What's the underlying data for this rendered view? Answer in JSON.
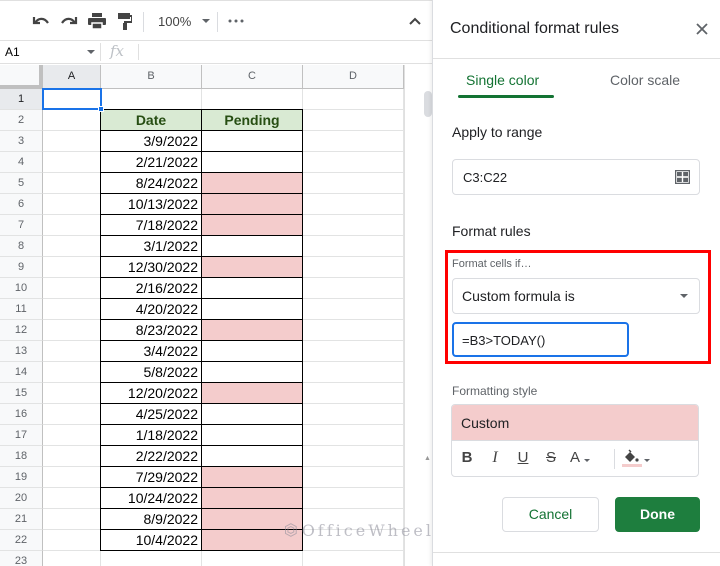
{
  "toolbar": {
    "undo_icon": "undo-icon",
    "redo_icon": "redo-icon",
    "print_icon": "print-icon",
    "paint_format_icon": "paint-format-icon",
    "zoom_level": "100%",
    "more_icon": "more-horizontal-icon",
    "collapse_icon": "chevron-up-icon"
  },
  "formula_bar": {
    "name_box": "A1",
    "fx_label": "fx",
    "formula_value": ""
  },
  "sheet": {
    "columns": [
      "A",
      "B",
      "C",
      "D"
    ],
    "selected_cell": "A1",
    "row_numbers": [
      "1",
      "2",
      "3",
      "4",
      "5",
      "6",
      "7",
      "8",
      "9",
      "10",
      "11",
      "12",
      "13",
      "14",
      "15",
      "16",
      "17",
      "18",
      "19",
      "20",
      "21",
      "22",
      "23"
    ],
    "table_headers": {
      "date": "Date",
      "pending": "Pending"
    },
    "rows": [
      {
        "row": "3",
        "date": "3/9/2022",
        "pending_highlight": false
      },
      {
        "row": "4",
        "date": "2/21/2022",
        "pending_highlight": false
      },
      {
        "row": "5",
        "date": "8/24/2022",
        "pending_highlight": true
      },
      {
        "row": "6",
        "date": "10/13/2022",
        "pending_highlight": true
      },
      {
        "row": "7",
        "date": "7/18/2022",
        "pending_highlight": true
      },
      {
        "row": "8",
        "date": "3/1/2022",
        "pending_highlight": false
      },
      {
        "row": "9",
        "date": "12/30/2022",
        "pending_highlight": true
      },
      {
        "row": "10",
        "date": "2/16/2022",
        "pending_highlight": false
      },
      {
        "row": "11",
        "date": "4/20/2022",
        "pending_highlight": false
      },
      {
        "row": "12",
        "date": "8/23/2022",
        "pending_highlight": true
      },
      {
        "row": "13",
        "date": "3/4/2022",
        "pending_highlight": false
      },
      {
        "row": "14",
        "date": "5/8/2022",
        "pending_highlight": false
      },
      {
        "row": "15",
        "date": "12/20/2022",
        "pending_highlight": true
      },
      {
        "row": "16",
        "date": "4/25/2022",
        "pending_highlight": false
      },
      {
        "row": "17",
        "date": "1/18/2022",
        "pending_highlight": false
      },
      {
        "row": "18",
        "date": "2/22/2022",
        "pending_highlight": false
      },
      {
        "row": "19",
        "date": "7/29/2022",
        "pending_highlight": true
      },
      {
        "row": "20",
        "date": "10/24/2022",
        "pending_highlight": true
      },
      {
        "row": "21",
        "date": "8/9/2022",
        "pending_highlight": true
      },
      {
        "row": "22",
        "date": "10/4/2022",
        "pending_highlight": true
      }
    ]
  },
  "watermark": "OfficeWheel",
  "panel": {
    "title": "Conditional format rules",
    "close_icon": "close-icon",
    "tabs": [
      {
        "label": "Single color",
        "active": true
      },
      {
        "label": "Color scale",
        "active": false
      }
    ],
    "apply_to_range_label": "Apply to range",
    "range_value": "C3:C22",
    "range_icon": "select-range-icon",
    "format_rules_label": "Format rules",
    "format_cells_if_label": "Format cells if…",
    "condition_selected": "Custom formula is",
    "formula_value": "=B3>TODAY()",
    "formatting_style_label": "Formatting style",
    "style_preview_label": "Custom",
    "style_tools": {
      "bold": "B",
      "italic": "I",
      "underline": "U",
      "strikethrough": "S",
      "text_color": "A"
    },
    "cancel_label": "Cancel",
    "done_label": "Done"
  },
  "colors": {
    "accent_green": "#137333",
    "done_button": "#1e7e3e",
    "highlight_fill": "#f4cccc",
    "header_fill": "#d9ead3",
    "header_text": "#274e13",
    "selection_blue": "#1a73e8",
    "annotation_red": "#ff0000"
  }
}
